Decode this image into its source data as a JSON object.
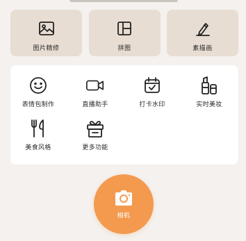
{
  "features": [
    {
      "label": "图片精修",
      "icon": "image-icon"
    },
    {
      "label": "拼图",
      "icon": "collage-icon"
    },
    {
      "label": "素描画",
      "icon": "sketch-icon"
    }
  ],
  "tools": [
    {
      "label": "表情包制作",
      "icon": "smiley-icon"
    },
    {
      "label": "直播助手",
      "icon": "video-camera-icon"
    },
    {
      "label": "打卡水印",
      "icon": "calendar-check-icon"
    },
    {
      "label": "实时美妆",
      "icon": "lipstick-icon"
    },
    {
      "label": "美食风格",
      "icon": "fork-knife-icon"
    },
    {
      "label": "更多功能",
      "icon": "gift-box-icon"
    }
  ],
  "camera": {
    "label": "相机",
    "icon": "camera-icon"
  },
  "colors": {
    "background": "#f4f1ee",
    "feature_card": "#e7ddd2",
    "accent": "#f39a4f"
  }
}
